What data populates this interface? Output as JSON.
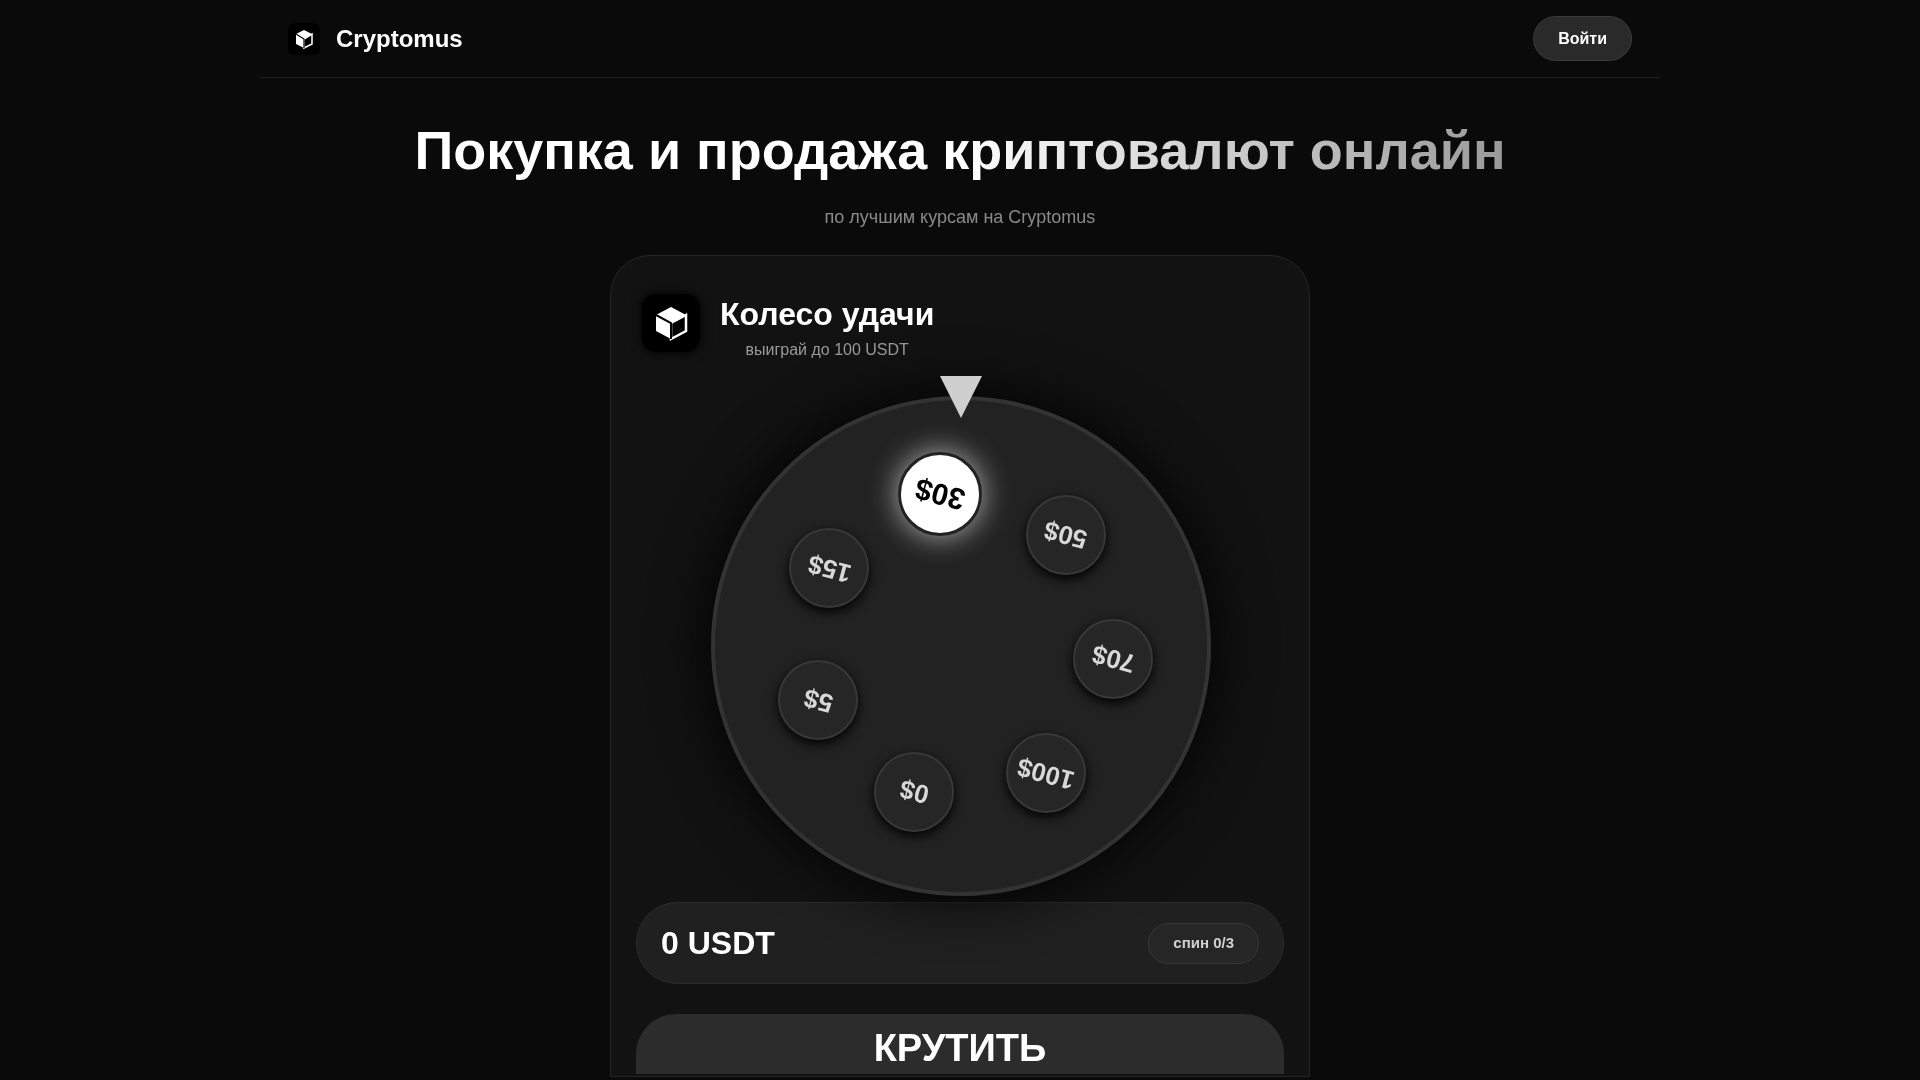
{
  "header": {
    "brand": "Cryptomus",
    "login_button": "Войти"
  },
  "hero": {
    "title": "Покупка и продажа криптовалют онлайн",
    "subtitle": "по лучшим курсам на Cryptomus"
  },
  "wheel_card": {
    "title": "Колесо удачи",
    "subtitle": "выиграй до 100 USDT",
    "segments": [
      {
        "label": "30$",
        "selected": true
      },
      {
        "label": "50$",
        "selected": false
      },
      {
        "label": "70$",
        "selected": false
      },
      {
        "label": "100$",
        "selected": false
      },
      {
        "label": "0$",
        "selected": false
      },
      {
        "label": "5$",
        "selected": false
      },
      {
        "label": "15$",
        "selected": false
      }
    ],
    "balance": "0 USDT",
    "spins": "спин 0/3",
    "spin_button": "КРУТИТЬ"
  }
}
